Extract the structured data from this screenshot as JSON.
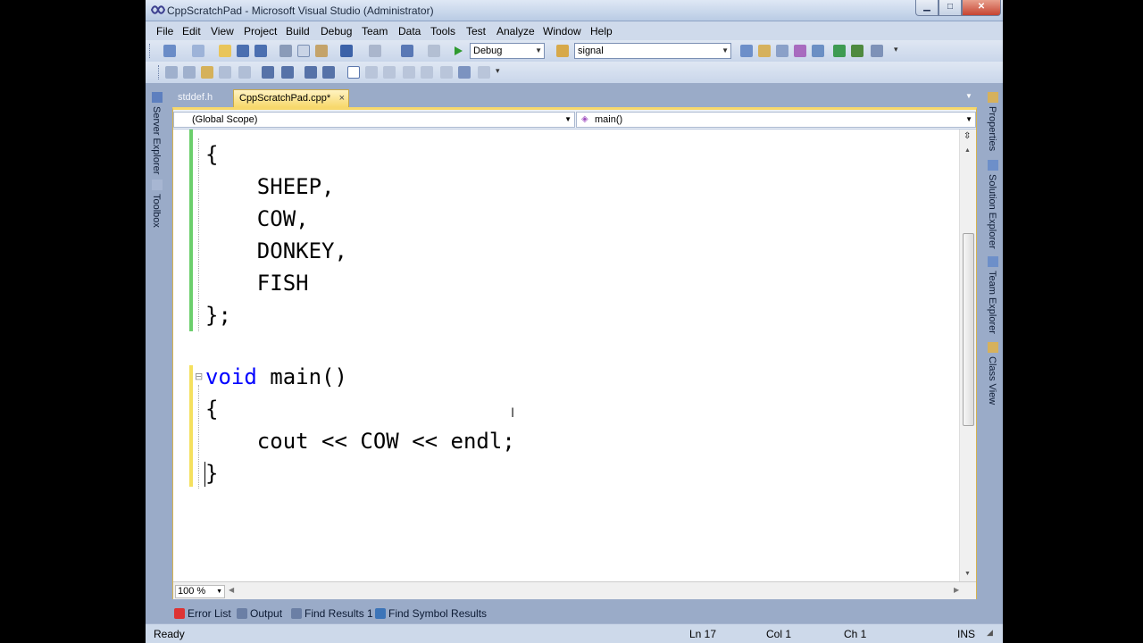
{
  "window": {
    "title": "CppScratchPad - Microsoft Visual Studio (Administrator)"
  },
  "menu": [
    "File",
    "Edit",
    "View",
    "Project",
    "Build",
    "Debug",
    "Team",
    "Data",
    "Tools",
    "Test",
    "Analyze",
    "Window",
    "Help"
  ],
  "toolbar": {
    "config": "Debug",
    "find_text": "signal"
  },
  "side_left": [
    "Server Explorer",
    "Toolbox"
  ],
  "side_right": [
    "Properties",
    "Solution Explorer",
    "Team Explorer",
    "Class View"
  ],
  "tabs": [
    {
      "label": "stddef.h"
    },
    {
      "label": "CppScratchPad.cpp*",
      "close": "×"
    }
  ],
  "nav": {
    "scope": "(Global Scope)",
    "member": "main()"
  },
  "code": {
    "lines": [
      "{",
      "    SHEEP,",
      "    COW,",
      "    DONKEY,",
      "    FISH",
      "};",
      "",
      "void",
      " main()",
      "{",
      "    cout << COW << endl;",
      "}"
    ]
  },
  "zoom": "100 %",
  "bottom_tabs": [
    "Error List",
    "Output",
    "Find Results 1",
    "Find Symbol Results"
  ],
  "status": {
    "state": "Ready",
    "ln": "Ln 17",
    "col": "Col 1",
    "ch": "Ch 1",
    "mode": "INS"
  }
}
